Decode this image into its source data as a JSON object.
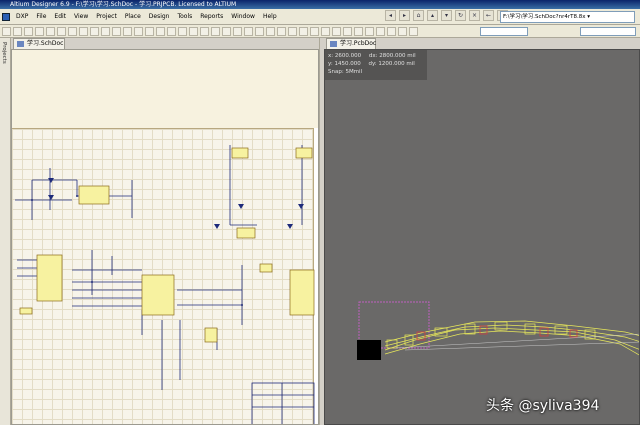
{
  "window": {
    "title": "Altium Designer 6.9 - F:\\学习\\学习.SchDoc - 学习.PRJPCB. Licensed to ALTIUM"
  },
  "menu": {
    "items": [
      "DXP",
      "File",
      "Edit",
      "View",
      "Project",
      "Place",
      "Design",
      "Tools",
      "Reports",
      "Window",
      "Help"
    ]
  },
  "toolbar": {
    "path": "F:\\学习\\学习.SchDoc?nr4rT8.8x ▾"
  },
  "panels": {
    "left_tab": "Projects"
  },
  "tabs": {
    "schematic": "学习.SchDoc",
    "pcb": "学习.PcbDoc"
  },
  "pcb": {
    "coords": {
      "x": "x:  2600.000",
      "dx": "dx:  2800.000  mil",
      "y": "y:  1450.000",
      "dy": "dy:  1200.000  mil",
      "snap": "Snap: 5Mmil"
    }
  },
  "watermark": {
    "text": "头条 @syliva394"
  },
  "colors": {
    "titlebar": "#0a246a",
    "pcb_background": "#6a6968",
    "component_fill": "#f7f2a0",
    "silkscreen": "#e8e85a",
    "pcb_selection": "#c060c0"
  }
}
